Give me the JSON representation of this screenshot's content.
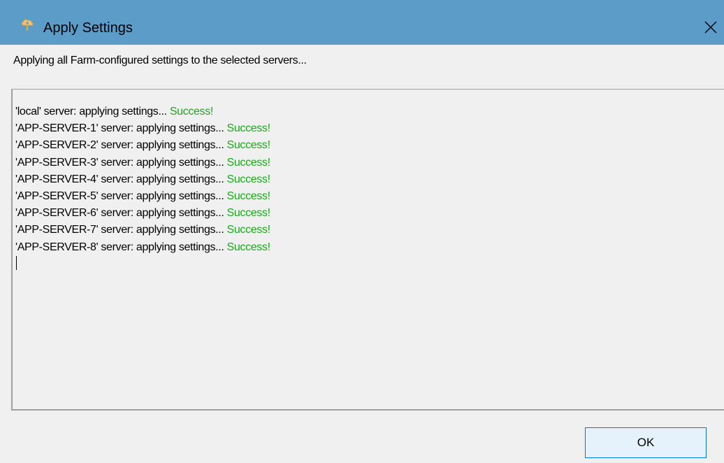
{
  "window": {
    "title": "Apply Settings",
    "app_icon": "cloud-gear-icon",
    "close_icon": "close-icon"
  },
  "description": "Applying all Farm-configured settings to the selected servers...",
  "log": {
    "lines": [
      {
        "message": "'local' server: applying settings... ",
        "status": "Success!"
      },
      {
        "message": "'APP-SERVER-1' server: applying settings... ",
        "status": "Success!"
      },
      {
        "message": "'APP-SERVER-2' server: applying settings... ",
        "status": "Success!"
      },
      {
        "message": "'APP-SERVER-3' server: applying settings... ",
        "status": "Success!"
      },
      {
        "message": "'APP-SERVER-4' server: applying settings... ",
        "status": "Success!"
      },
      {
        "message": "'APP-SERVER-5' server: applying settings... ",
        "status": "Success!"
      },
      {
        "message": "'APP-SERVER-6' server: applying settings... ",
        "status": "Success!"
      },
      {
        "message": "'APP-SERVER-7' server: applying settings... ",
        "status": "Success!"
      },
      {
        "message": "'APP-SERVER-8' server: applying settings... ",
        "status": "Success!"
      }
    ]
  },
  "buttons": {
    "ok_label": "OK"
  },
  "colors": {
    "titlebar": "#5b9cc9",
    "success_text": "#1fa61f",
    "dialog_background": "#f0f0f0",
    "ok_button_border": "#0078d7"
  }
}
